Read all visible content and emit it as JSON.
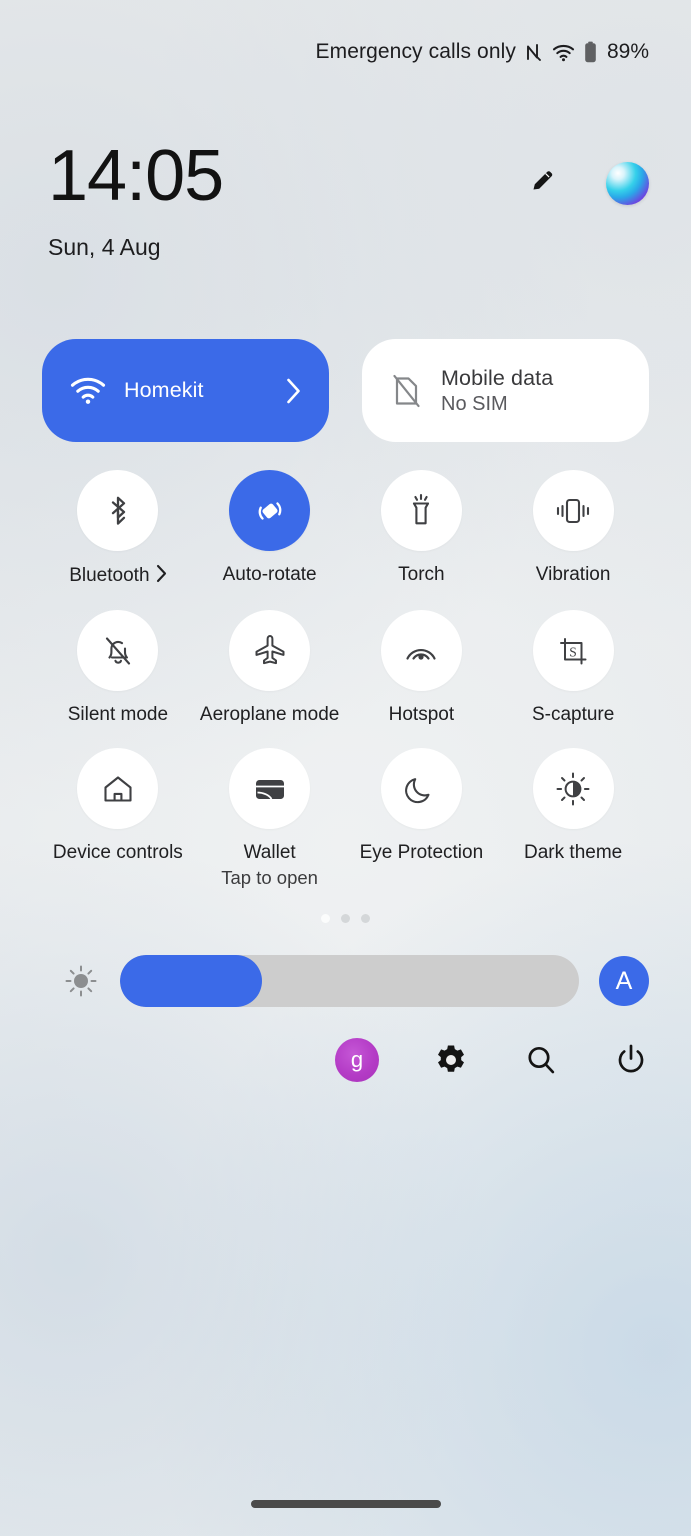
{
  "status_bar": {
    "carrier_text": "Emergency calls only",
    "nfc_icon": "nfc-icon",
    "wifi_icon": "wifi-icon",
    "battery_icon": "battery-icon",
    "battery_percent": "89%"
  },
  "header": {
    "time": "14:05",
    "date": "Sun, 4 Aug",
    "edit_icon": "pencil-edit-icon",
    "assistant_icon": "bixby-orb-icon"
  },
  "big_tiles": [
    {
      "name": "wifi-tile",
      "title": "Homekit",
      "subtitle": "",
      "icon": "wifi-icon",
      "state": "on",
      "has_chevron": true
    },
    {
      "name": "mobile-data-tile",
      "title": "Mobile data",
      "subtitle": "No SIM",
      "icon": "sim-off-icon",
      "state": "off",
      "has_chevron": false
    }
  ],
  "toggles": [
    {
      "label": "Bluetooth",
      "sub": "",
      "icon": "bluetooth-icon",
      "state": "off",
      "chevron": true
    },
    {
      "label": "Auto-rotate",
      "sub": "",
      "icon": "auto-rotate-icon",
      "state": "on",
      "chevron": false
    },
    {
      "label": "Torch",
      "sub": "",
      "icon": "torch-icon",
      "state": "off",
      "chevron": false
    },
    {
      "label": "Vibration",
      "sub": "",
      "icon": "vibration-icon",
      "state": "off",
      "chevron": false
    },
    {
      "label": "Silent mode",
      "sub": "",
      "icon": "bell-off-icon",
      "state": "off",
      "chevron": false
    },
    {
      "label": "Aeroplane mode",
      "sub": "",
      "icon": "airplane-icon",
      "state": "off",
      "chevron": false
    },
    {
      "label": "Hotspot",
      "sub": "",
      "icon": "hotspot-icon",
      "state": "off",
      "chevron": false
    },
    {
      "label": "S-capture",
      "sub": "",
      "icon": "screen-capture-icon",
      "state": "off",
      "chevron": false
    },
    {
      "label": "Device controls",
      "sub": "",
      "icon": "home-house-icon",
      "state": "off",
      "chevron": false
    },
    {
      "label": "Wallet",
      "sub": "Tap to open",
      "icon": "wallet-icon",
      "state": "off",
      "chevron": false
    },
    {
      "label": "Eye Protection",
      "sub": "",
      "icon": "moon-icon",
      "state": "off",
      "chevron": false
    },
    {
      "label": "Dark theme",
      "sub": "",
      "icon": "dark-theme-sun-icon",
      "state": "off",
      "chevron": false
    }
  ],
  "page_indicator": {
    "total": 3,
    "active_index": 0
  },
  "brightness": {
    "sun_icon": "brightness-sun-icon",
    "fill_percent": "31%",
    "auto_label": "A"
  },
  "bottom_bar": {
    "avatar_initial": "g",
    "settings_icon": "gear-icon",
    "search_icon": "search-icon",
    "power_icon": "power-icon"
  },
  "colors": {
    "accent_blue": "#3B6AE8",
    "avatar_purple": "#B43CC6",
    "tile_off": "#FFFFFF",
    "slider_track": "#CDCDCD",
    "text_primary": "#202022"
  },
  "home_indicator": "home-gesture-bar"
}
